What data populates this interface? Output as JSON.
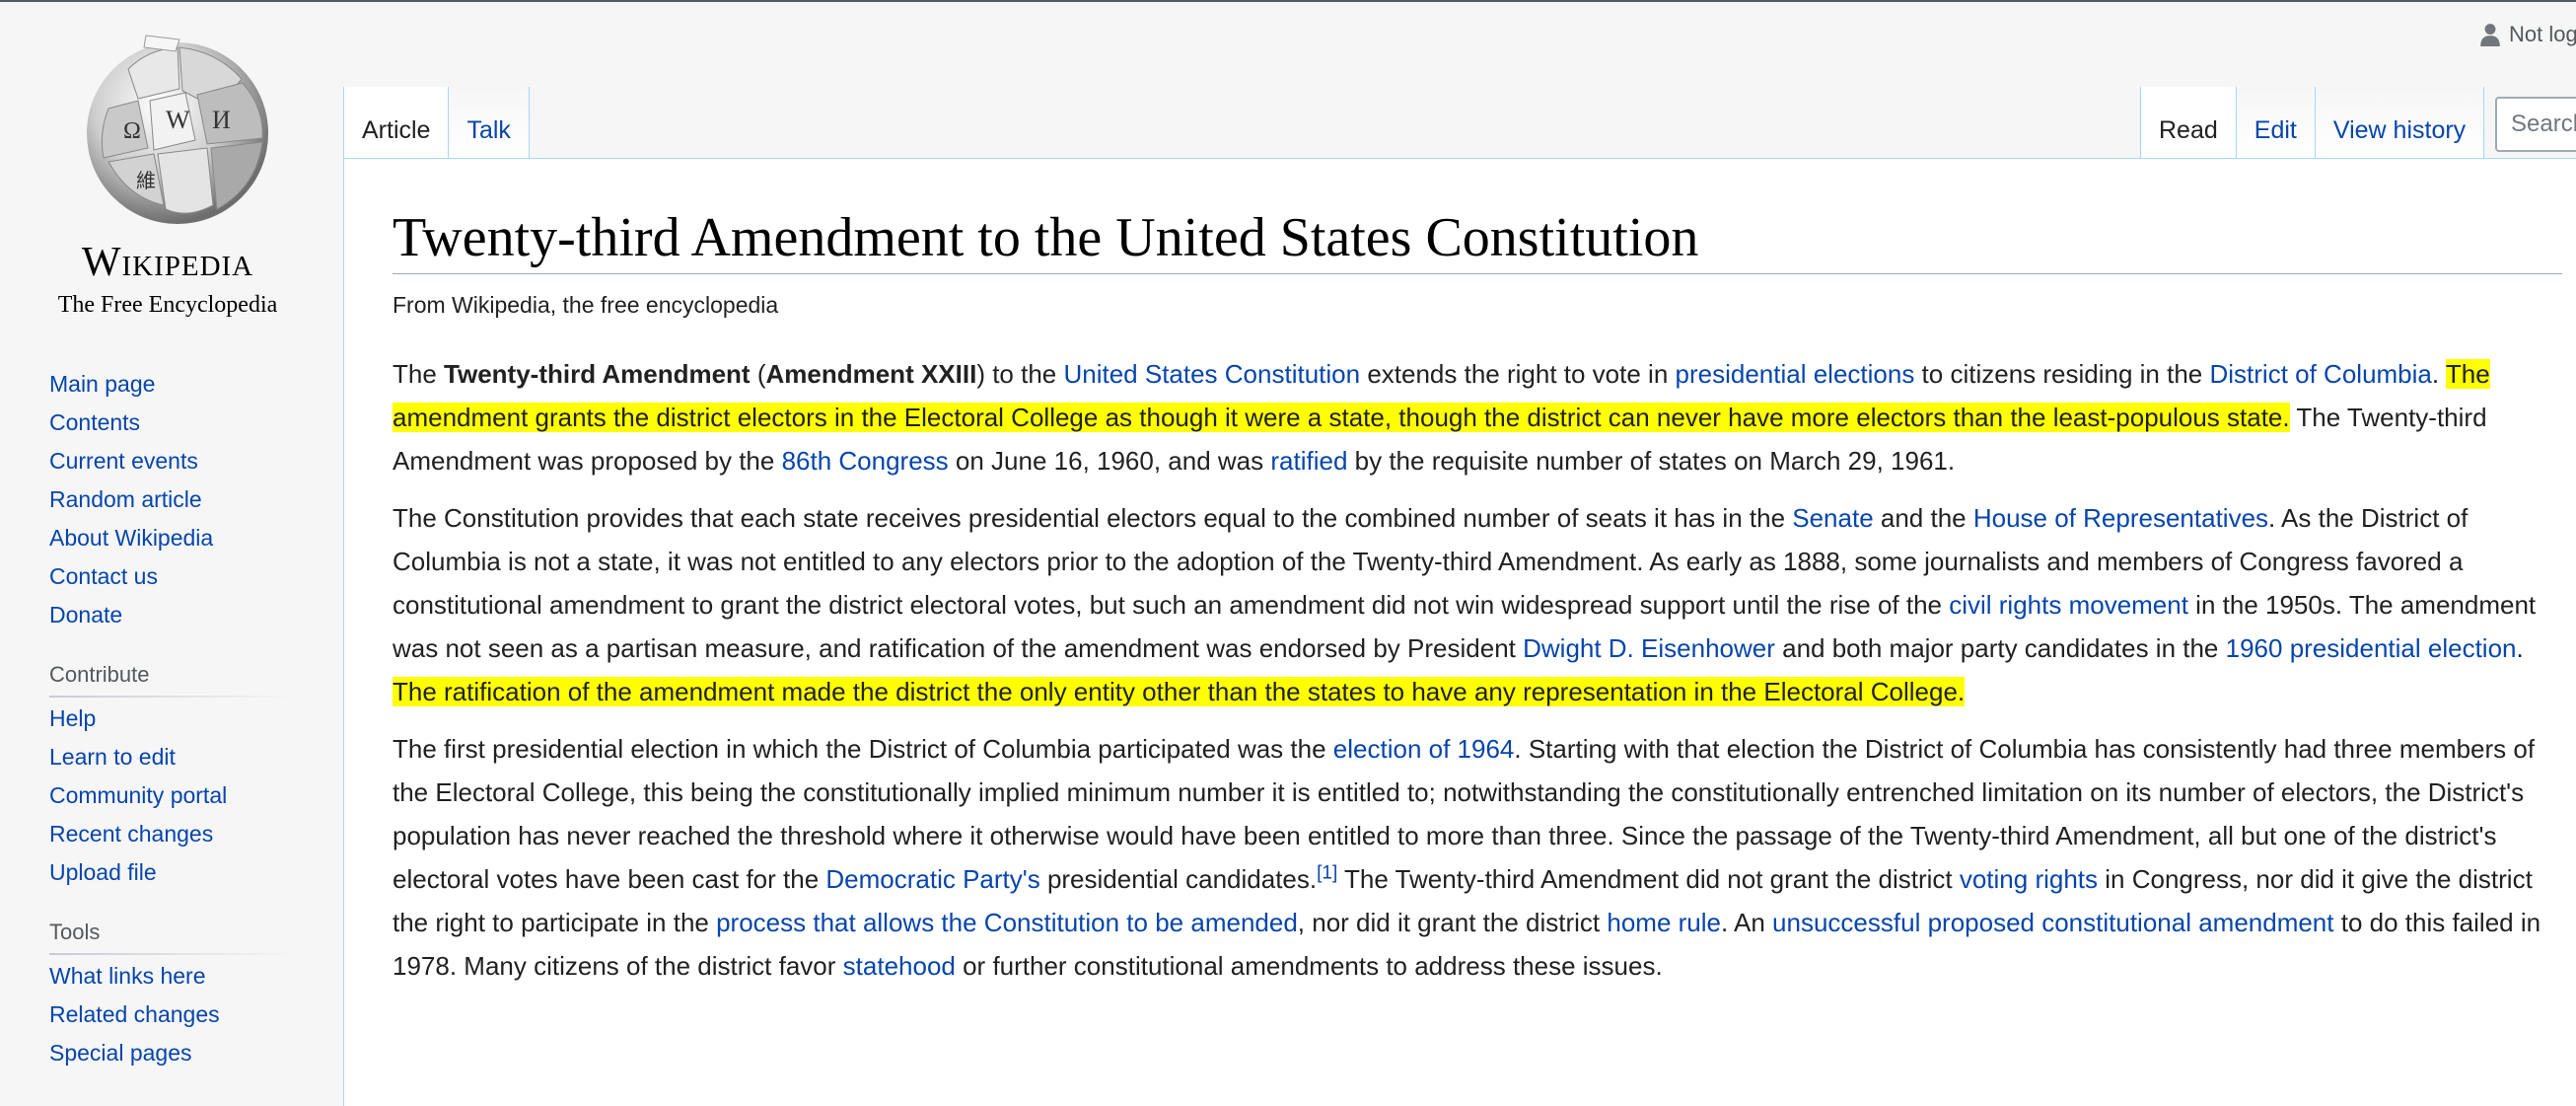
{
  "logo": {
    "wordmark": "Wikipedia",
    "tagline": "The Free Encyclopedia"
  },
  "user": {
    "label": "Not log"
  },
  "tabs": {
    "article": "Article",
    "talk": "Talk",
    "read": "Read",
    "edit": "Edit",
    "history": "View history"
  },
  "search": {
    "placeholder": "Search"
  },
  "sidebar": {
    "nav": [
      "Main page",
      "Contents",
      "Current events",
      "Random article",
      "About Wikipedia",
      "Contact us",
      "Donate"
    ],
    "contribute_heading": "Contribute",
    "contribute": [
      "Help",
      "Learn to edit",
      "Community portal",
      "Recent changes",
      "Upload file"
    ],
    "tools_heading": "Tools",
    "tools": [
      "What links here",
      "Related changes",
      "Special pages"
    ]
  },
  "article": {
    "title": "Twenty-third Amendment to the United States Constitution",
    "sitesub": "From Wikipedia, the free encyclopedia",
    "p1": {
      "t1": "The ",
      "b1": "Twenty-third Amendment",
      "t2": " (",
      "b2": "Amendment XXIII",
      "t3": ") to the ",
      "l1": "United States Constitution",
      "t4": " extends the right to vote in ",
      "l2": "presidential elections",
      "t5": " to citizens residing in the ",
      "l3": "District of Columbia",
      "t6": ". ",
      "h1": "The amendment grants the district electors in the Electoral College as though it were a state, though the district can never have more electors than the least-populous state.",
      "t7": " The Twenty-third Amendment was proposed by the ",
      "l4": "86th Congress",
      "t8": " on June 16, 1960, and was ",
      "l5": "ratified",
      "t9": " by the requisite number of states on March 29, 1961."
    },
    "p2": {
      "t1": "The Constitution provides that each state receives presidential electors equal to the combined number of seats it has in the ",
      "l1": "Senate",
      "t2": " and the ",
      "l2": "House of Representatives",
      "t3": ". As the District of Columbia is not a state, it was not entitled to any electors prior to the adoption of the Twenty-third Amendment. As early as 1888, some journalists and members of Congress favored a constitutional amendment to grant the district electoral votes, but such an amendment did not win widespread support until the rise of the ",
      "l3": "civil rights movement",
      "t4": " in the 1950s. The amendment was not seen as a partisan measure, and ratification of the amendment was endorsed by President ",
      "l4": "Dwight D. Eisenhower",
      "t5": " and both major party candidates in the ",
      "l5": "1960 presidential election",
      "t6": ". ",
      "h1": "The ratification of the amendment made the district the only entity other than the states to have any representation in the Electoral College."
    },
    "p3": {
      "t1": "The first presidential election in which the District of Columbia participated was the ",
      "l1": "election of 1964",
      "t2": ". Starting with that election the District of Columbia has consistently had three members of the Electoral College, this being the constitutionally implied minimum number it is entitled to; notwithstanding the constitutionally entrenched limitation on its number of electors, the District's population has never reached the threshold where it otherwise would have been entitled to more than three. Since the passage of the Twenty-third Amendment, all but one of the district's electoral votes have been cast for the ",
      "l2": "Democratic Party's",
      "t3": " presidential candidates.",
      "sup": "[1]",
      "t4": " The Twenty-third Amendment did not grant the district ",
      "l3": "voting rights",
      "t5": " in Congress, nor did it give the district the right to participate in the ",
      "l4": "process that allows the Constitution to be amended",
      "t6": ", nor did it grant the district ",
      "l5": "home rule",
      "t7": ". An ",
      "l6": "unsuccessful proposed constitutional amendment",
      "t8": " to do this failed in 1978. Many citizens of the district favor ",
      "l7": "statehood",
      "t9": " or further constitutional amendments to address these issues."
    }
  }
}
